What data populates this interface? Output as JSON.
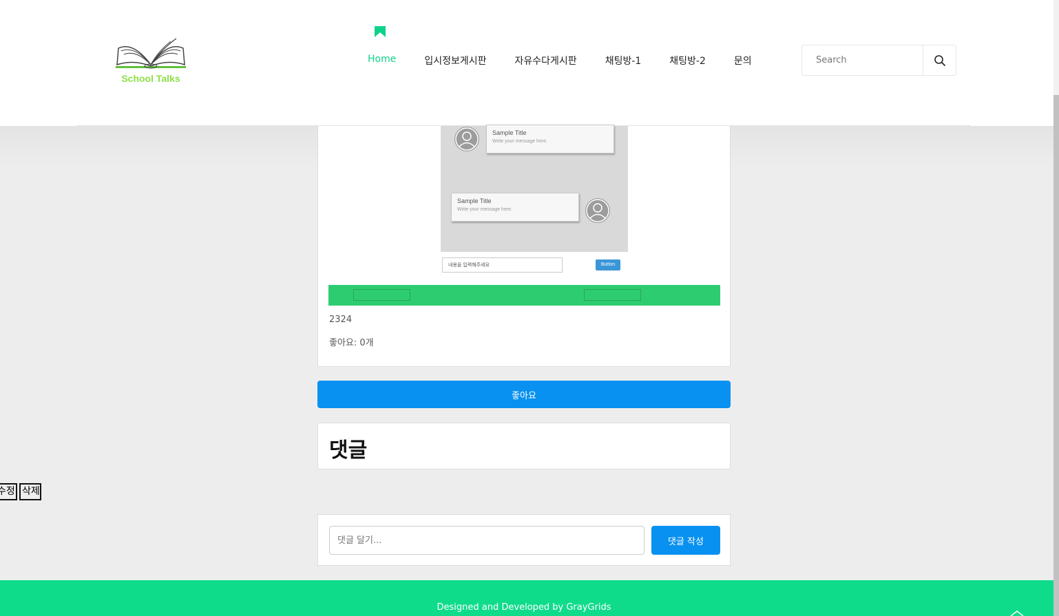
{
  "header": {
    "logo_text": "School Talks",
    "nav": [
      "Home",
      "입시정보게시판",
      "자유수다게시판",
      "채팅방-1",
      "채팅방-2",
      "문의"
    ],
    "active_index": 0,
    "search_placeholder": "Search"
  },
  "post": {
    "mockup": {
      "bubble1_title": "Sample Title",
      "bubble1_text": "Write your message here.",
      "bubble2_title": "Sample Title",
      "bubble2_text": "Write your message here.",
      "input_text": "내용을 입력해주세요",
      "button_text": "Button"
    },
    "number": "2324",
    "likes_label": "좋아요: 0개"
  },
  "like_button": "좋아요",
  "comments": {
    "title": "댓글"
  },
  "actions": {
    "edit": "수정",
    "delete": "삭제"
  },
  "comment_form": {
    "placeholder": "댓글 달기...",
    "submit": "댓글 작성"
  },
  "footer": {
    "text": "Designed and Developed by GrayGrids"
  },
  "colors": {
    "accent": "#0fd28a",
    "primary_button": "#0891f0",
    "green_bar": "#2ecc71",
    "footer": "#0fdc8b"
  }
}
